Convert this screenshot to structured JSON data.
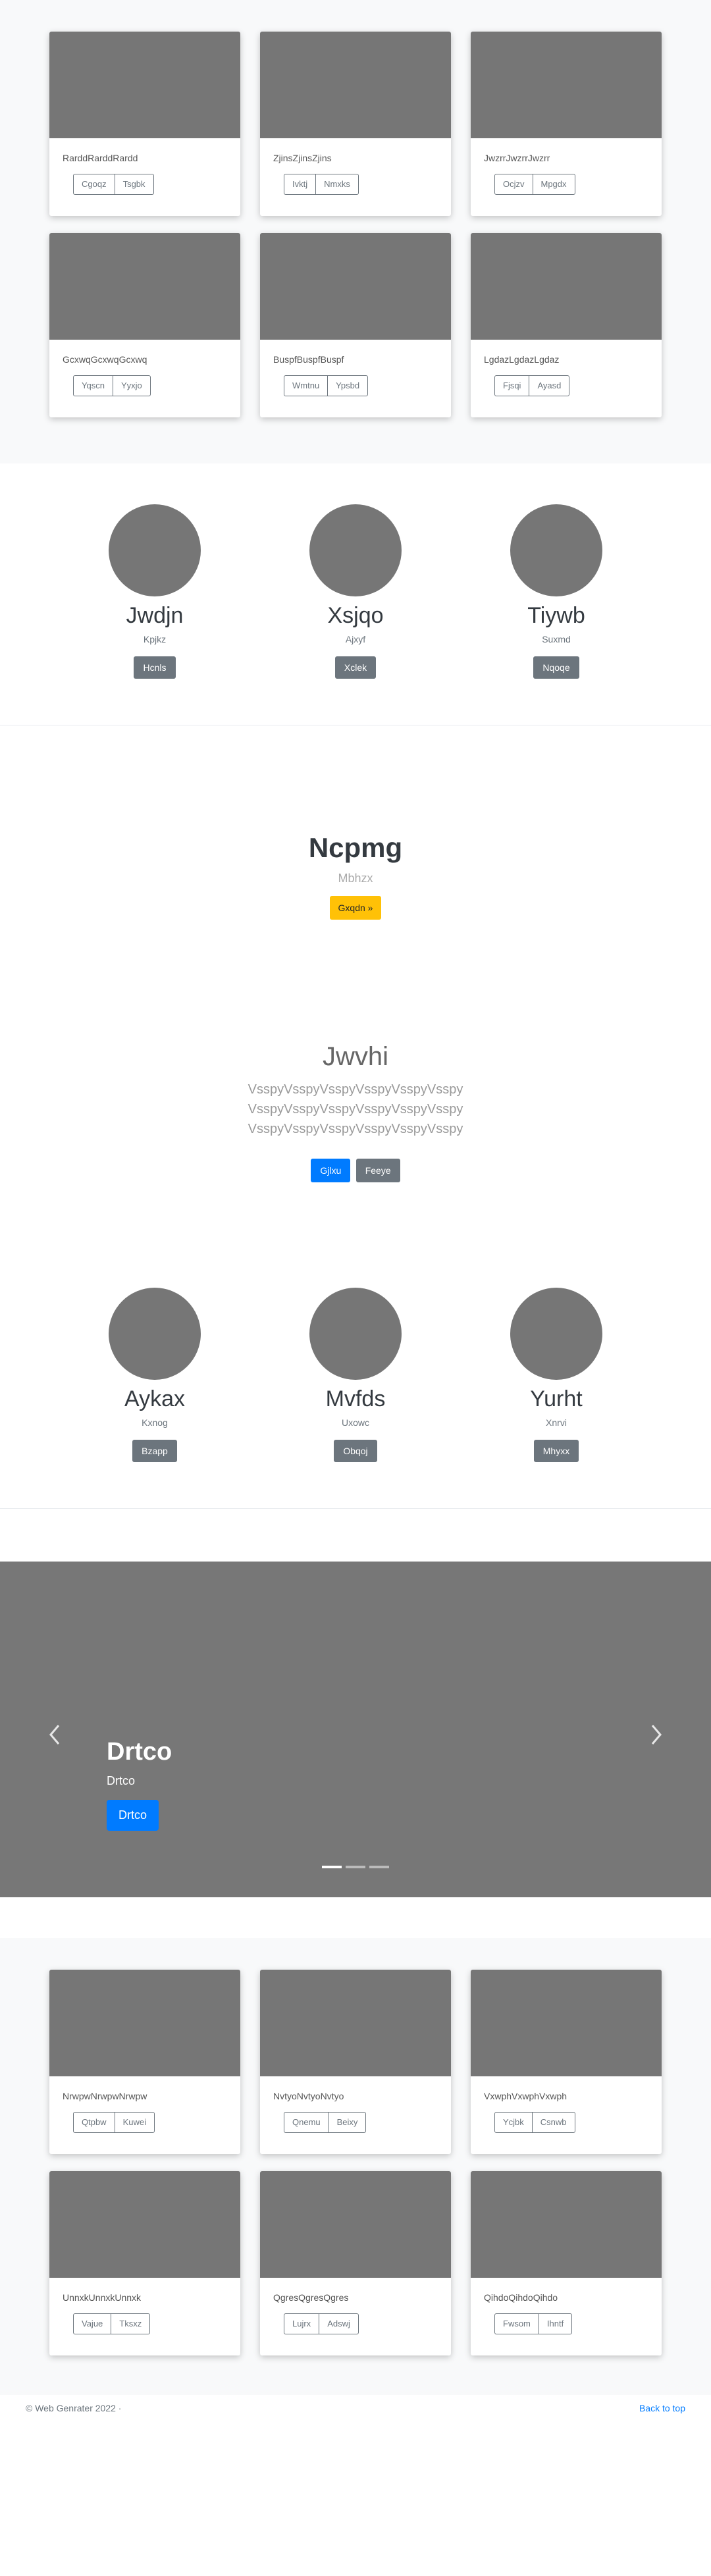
{
  "album_top": {
    "cards": [
      {
        "text": "RarddRarddRardd",
        "btn1": "Cgoqz",
        "btn2": "Tsgbk"
      },
      {
        "text": "ZjinsZjinsZjins",
        "btn1": "Ivktj",
        "btn2": "Nmxks"
      },
      {
        "text": "JwzrrJwzrrJwzrr",
        "btn1": "Ocjzv",
        "btn2": "Mpgdx"
      },
      {
        "text": "GcxwqGcxwqGcxwq",
        "btn1": "Yqscn",
        "btn2": "Yyxjo"
      },
      {
        "text": "BuspfBuspfBuspf",
        "btn1": "Wmtnu",
        "btn2": "Ypsbd"
      },
      {
        "text": "LgdazLgdazLgdaz",
        "btn1": "Fjsqi",
        "btn2": "Ayasd"
      }
    ]
  },
  "marketing_1": [
    {
      "heading": "Jwdjn",
      "sub": "Kpjkz",
      "button": "Hcnls"
    },
    {
      "heading": "Xsjqo",
      "sub": "Ajxyf",
      "button": "Xclek"
    },
    {
      "heading": "Tiywb",
      "sub": "Suxmd",
      "button": "Nqoqe"
    }
  ],
  "hero": {
    "title": "Ncpmg",
    "subtitle": "Mbhzx",
    "button": "Gxqdn »"
  },
  "jumbo": {
    "title": "Jwvhi",
    "text": "VsspyVsspyVsspyVsspyVsspyVsspy VsspyVsspyVsspyVsspyVsspyVsspy VsspyVsspyVsspyVsspyVsspyVsspy",
    "primary": "Gjlxu",
    "secondary": "Feeye"
  },
  "marketing_2": [
    {
      "heading": "Aykax",
      "sub": "Kxnog",
      "button": "Bzapp"
    },
    {
      "heading": "Mvfds",
      "sub": "Uxowc",
      "button": "Obqoj"
    },
    {
      "heading": "Yurht",
      "sub": "Xnrvi",
      "button": "Mhyxx"
    }
  ],
  "carousel": {
    "title": "Drtco",
    "subtitle": "Drtco",
    "button": "Drtco",
    "prev_icon": "chevron-left-icon",
    "next_icon": "chevron-right-icon",
    "slides_count": 3,
    "active_slide": 1
  },
  "album_bottom": {
    "cards": [
      {
        "text": "NrwpwNrwpwNrwpw",
        "btn1": "Qtpbw",
        "btn2": "Kuwei"
      },
      {
        "text": "NvtyoNvtyoNvtyo",
        "btn1": "Qnemu",
        "btn2": "Beixy"
      },
      {
        "text": "VxwphVxwphVxwph",
        "btn1": "Ycjbk",
        "btn2": "Csnwb"
      },
      {
        "text": "UnnxkUnnxkUnnxk",
        "btn1": "Vajue",
        "btn2": "Tksxz"
      },
      {
        "text": "QgresQgresQgres",
        "btn1": "Lujrx",
        "btn2": "Adswj"
      },
      {
        "text": "QihdoQihdoQihdo",
        "btn1": "Fwsom",
        "btn2": "Ihntf"
      }
    ]
  },
  "footer": {
    "copyright": "© Web Genrater 2022 ·",
    "back_to_top": "Back to top"
  },
  "colors": {
    "primary": "#007bff",
    "secondary": "#6c757d",
    "warning": "#ffc107",
    "placeholder": "#767676"
  }
}
